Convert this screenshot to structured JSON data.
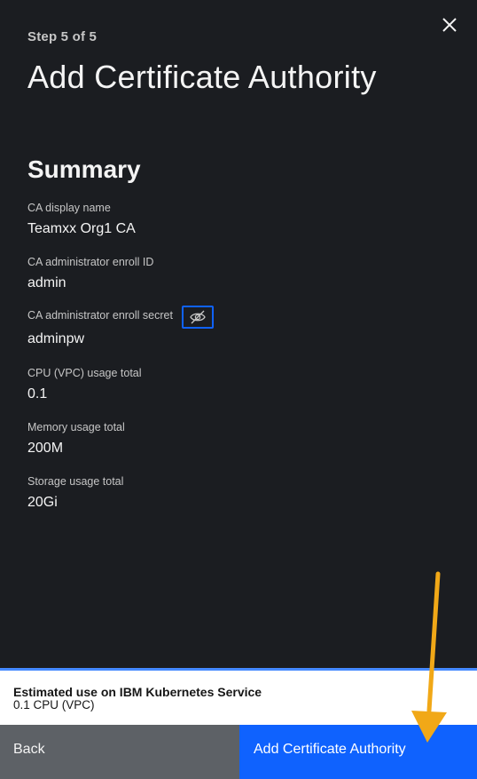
{
  "header": {
    "step": "Step 5 of 5",
    "title": "Add Certificate Authority"
  },
  "summary": {
    "heading": "Summary",
    "fields": [
      {
        "label": "CA display name",
        "value": "Teamxx Org1 CA"
      },
      {
        "label": "CA administrator enroll ID",
        "value": "admin"
      },
      {
        "label": "CA administrator enroll secret",
        "value": "adminpw"
      },
      {
        "label": "CPU (VPC) usage total",
        "value": "0.1"
      },
      {
        "label": "Memory usage total",
        "value": "200M"
      },
      {
        "label": "Storage usage total",
        "value": "20Gi"
      }
    ]
  },
  "estimate": {
    "title": "Estimated use on IBM Kubernetes Service",
    "value": "0.1 CPU (VPC)"
  },
  "footer": {
    "back_label": "Back",
    "submit_label": "Add Certificate Authority"
  },
  "icons": {
    "close": "close-icon",
    "visibility": "eye-off-icon"
  },
  "colors": {
    "panel_bg": "#1b1d21",
    "primary": "#0f62fe",
    "secondary": "#5d6166",
    "annotation_arrow": "#f1a817"
  }
}
